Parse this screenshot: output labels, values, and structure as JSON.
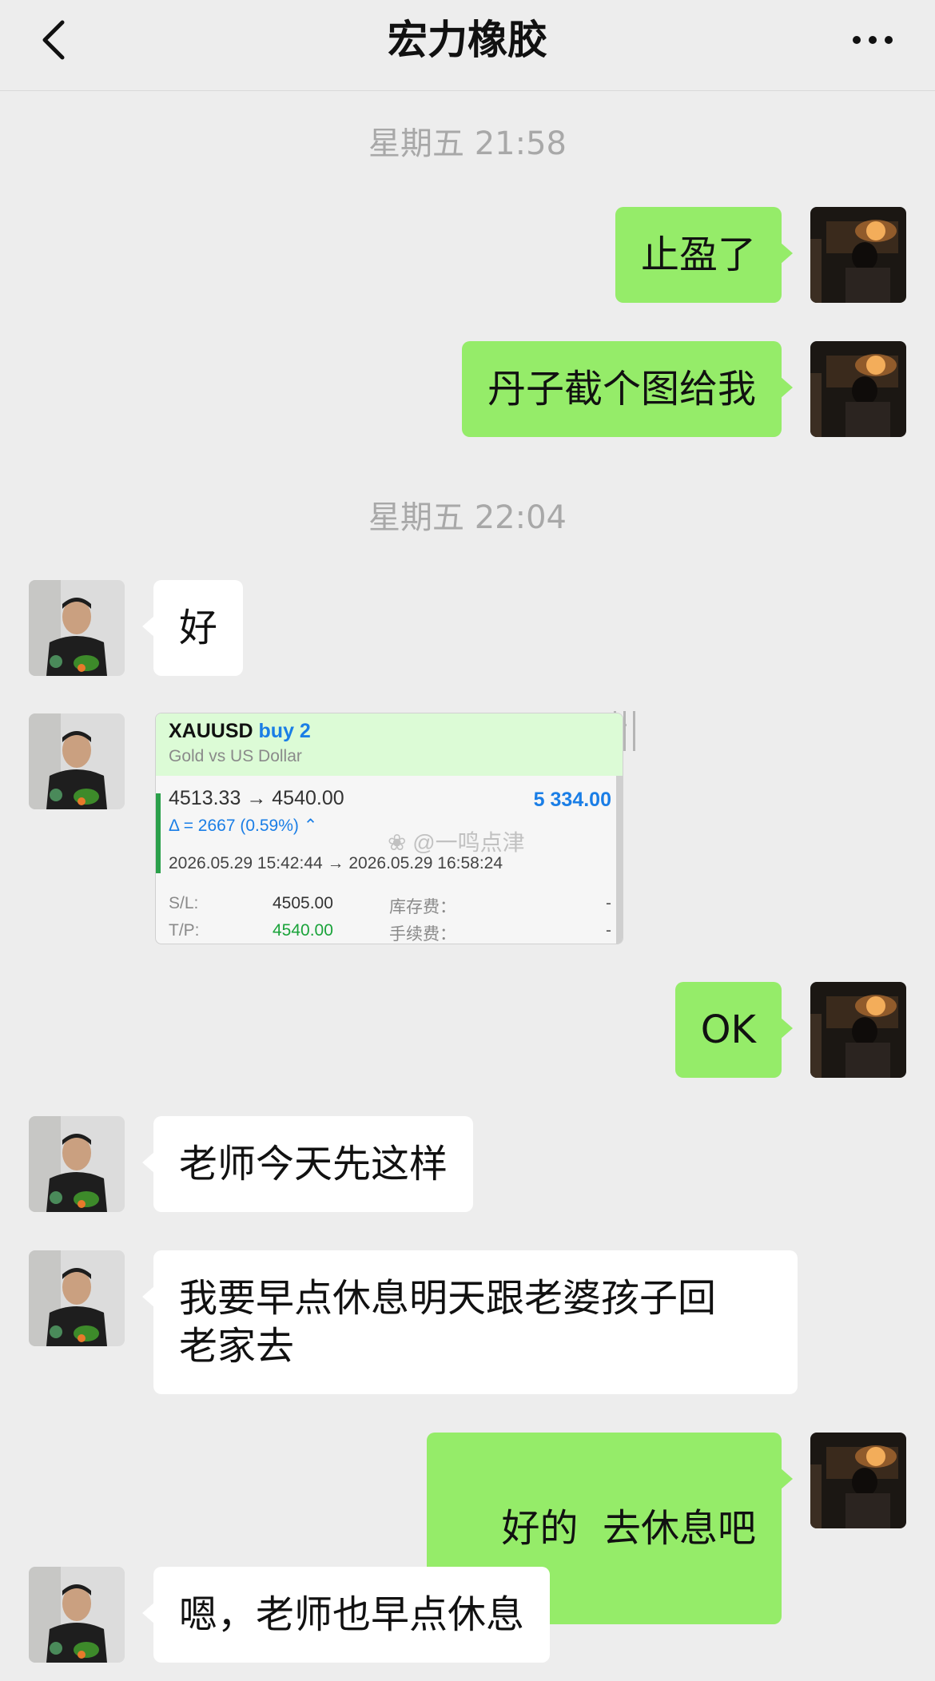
{
  "header": {
    "title": "宏力橡胶"
  },
  "timestamps": [
    "星期五 21:58",
    "星期五 22:04"
  ],
  "messages": [
    {
      "side": "right",
      "text": "止盈了"
    },
    {
      "side": "right",
      "text": "丹子截个图给我"
    },
    {
      "side": "left",
      "text": "好"
    },
    {
      "side": "right",
      "text": "OK"
    },
    {
      "side": "left",
      "text": "老师今天先这样"
    },
    {
      "side": "left",
      "line1": "我要早点休息明天跟老婆孩子回",
      "line2": "老家去"
    },
    {
      "side": "right",
      "text": "好的  去休息吧"
    },
    {
      "side": "left",
      "text": "嗯，老师也早点休息"
    }
  ],
  "trade_card": {
    "symbol": "XAUUSD",
    "side": "buy 2",
    "description": "Gold vs US Dollar",
    "prices": "4513.33 → 4540.00",
    "profit": "5 334.00",
    "delta": "Δ = 2667 (0.59%) ⌃",
    "times": "2026.05.29 15:42:44 → 2026.05.29 16:58:24",
    "sl_label": "S/L:",
    "sl_value": "4505.00",
    "tp_label": "T/P:",
    "tp_value": "4540.00",
    "swap_label": "库存费：",
    "swap_value": "-",
    "fee_label": "手续费：",
    "fee_value": "-",
    "watermark": "@一鸣点津"
  },
  "colors": {
    "background": "#ededed",
    "bubble_right": "#95ec69",
    "bubble_left": "#ffffff",
    "timestamp": "#a8a8a8",
    "accent_blue": "#1a7ee6"
  },
  "icons": {
    "back": "chevron-left-icon",
    "more": "more-dots-icon"
  }
}
